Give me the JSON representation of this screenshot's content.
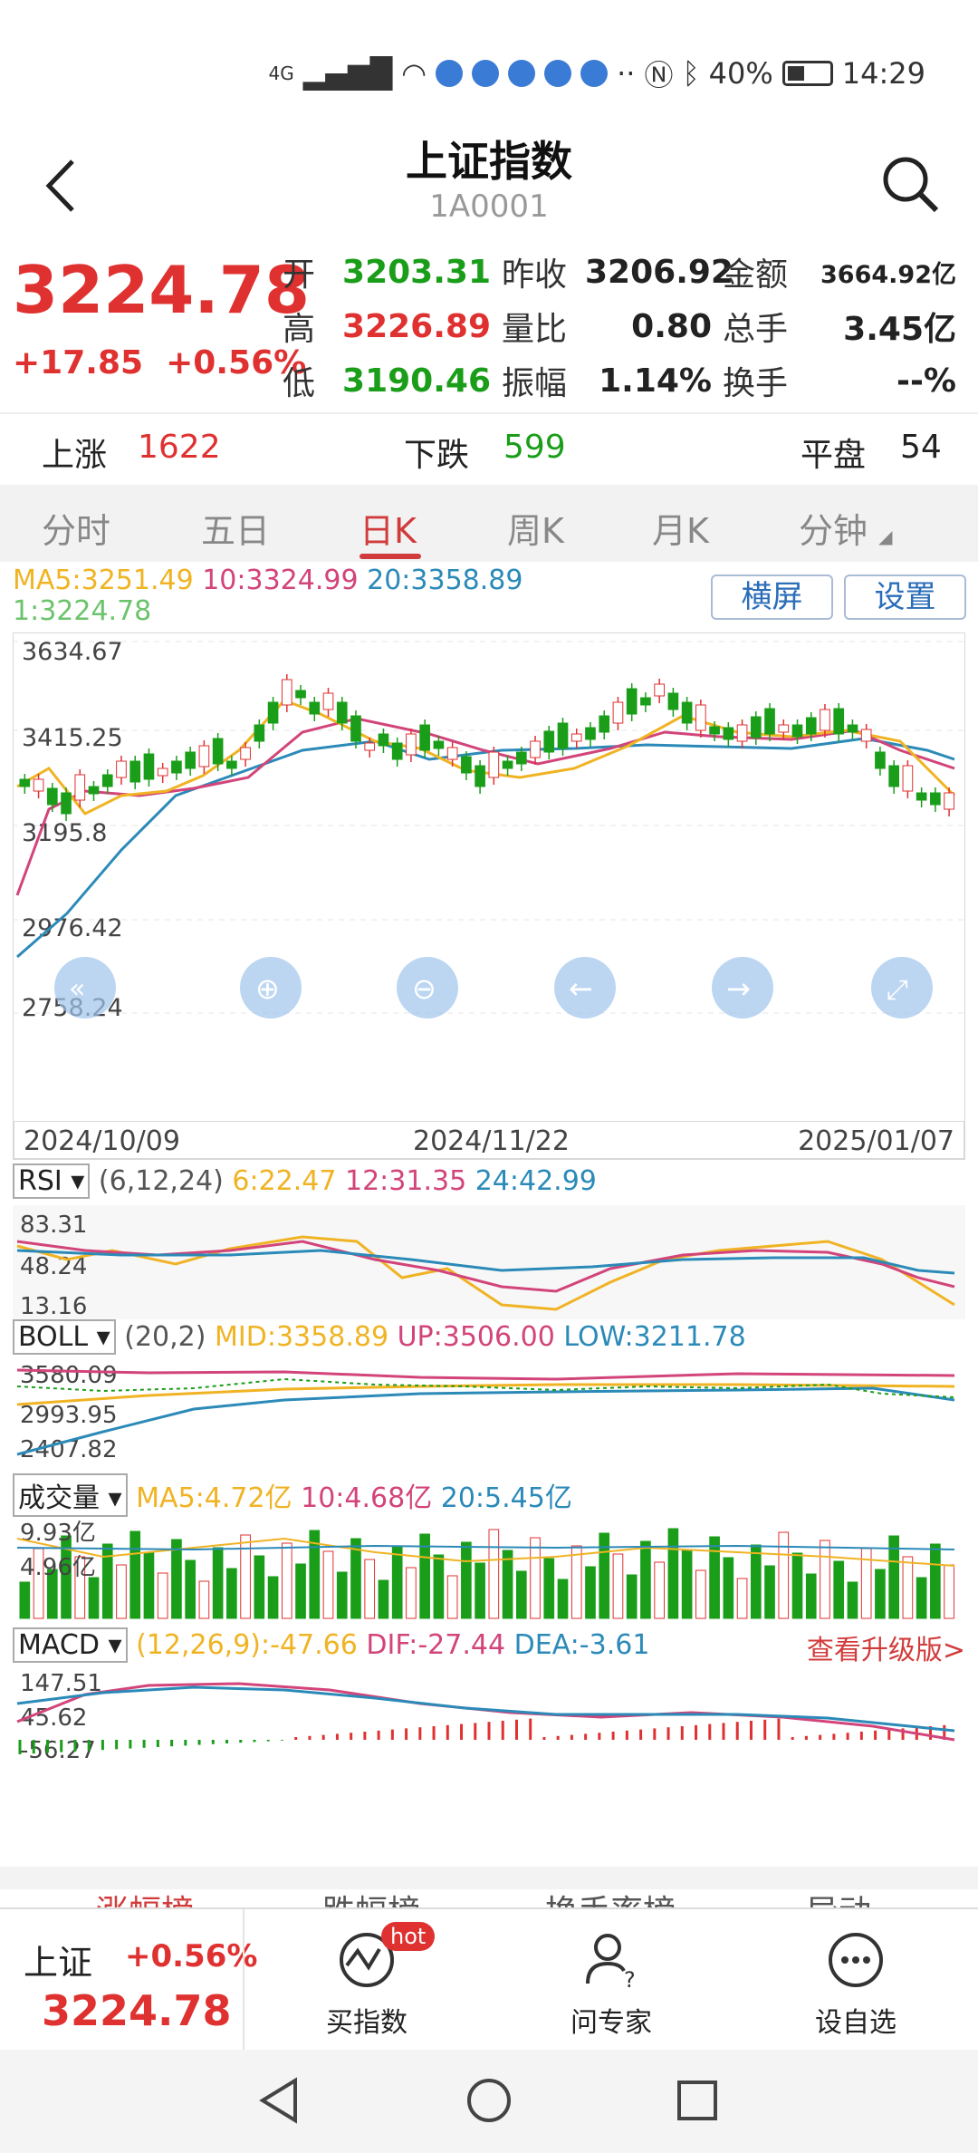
{
  "status": {
    "network": "4G",
    "battery": "40%",
    "time": "14:29"
  },
  "header": {
    "title": "上证指数",
    "code": "1A0001"
  },
  "quote": {
    "price": "3224.78",
    "change": "+17.85",
    "change_pct": "+0.56%",
    "rows": [
      {
        "l1": "开",
        "v1": "3203.31",
        "l2": "昨收",
        "v2": "3206.92",
        "l3": "金额",
        "v3": "3664.92亿"
      },
      {
        "l1": "高",
        "v1": "3226.89",
        "l2": "量比",
        "v2": "0.80",
        "l3": "总手",
        "v3": "3.45亿"
      },
      {
        "l1": "低",
        "v1": "3190.46",
        "l2": "振幅",
        "v2": "1.14%",
        "l3": "换手",
        "v3": "--%"
      }
    ]
  },
  "breadth": {
    "up_label": "上涨",
    "up": "1622",
    "down_label": "下跌",
    "down": "599",
    "flat_label": "平盘",
    "flat": "54"
  },
  "tabs": [
    "分时",
    "五日",
    "日K",
    "周K",
    "月K",
    "分钟"
  ],
  "active_tab": "日K",
  "ma": {
    "ma5": "MA5:3251.49",
    "ma10": "10:3324.99",
    "ma20": "20:3358.89",
    "last": "1:3224.78"
  },
  "buttons": {
    "landscape": "横屏",
    "settings": "设置"
  },
  "kline": {
    "y_ticks": [
      "3634.67",
      "3415.25",
      "3195.8",
      "2976.42",
      "2758.24"
    ],
    "x_ticks": [
      "2024/10/09",
      "2024/11/22",
      "2025/01/07"
    ]
  },
  "rsi": {
    "name": "RSI",
    "params": "(6,12,24)",
    "r6": "6:22.47",
    "r12": "12:31.35",
    "r24": "24:42.99",
    "ticks": [
      "83.31",
      "48.24",
      "13.16"
    ]
  },
  "boll": {
    "name": "BOLL",
    "params": "(20,2)",
    "mid": "MID:3358.89",
    "up": "UP:3506.00",
    "low": "LOW:3211.78",
    "ticks": [
      "3580.09",
      "2993.95",
      "2407.82"
    ]
  },
  "vol": {
    "name": "成交量",
    "ma5": "MA5:4.72亿",
    "ma10": "10:4.68亿",
    "ma20": "20:5.45亿",
    "ticks": [
      "9.93亿",
      "4.96亿"
    ]
  },
  "macd": {
    "name": "MACD",
    "params": "(12,26,9):-47.66",
    "dif": "DIF:-27.44",
    "dea": "DEA:-3.61",
    "upgrade": "查看升级版>",
    "ticks": [
      "147.51",
      "45.62",
      "-56.27"
    ]
  },
  "peek_tabs": [
    "涨幅榜",
    "跌幅榜",
    "换手率榜",
    "异动"
  ],
  "bottombar": {
    "name": "上证",
    "change_pct": "+0.56%",
    "price": "3224.78",
    "buy": "买指数",
    "hot": "hot",
    "ask": "问专家",
    "watch": "设自选"
  },
  "colors": {
    "up": "#e03131",
    "down": "#1a9e1a",
    "ma5": "#f0b323",
    "ma10": "#d2447a",
    "ma20": "#2b8ab8"
  },
  "chart_data": {
    "type": "candlestick",
    "x_range": [
      "2024/10/09",
      "2025/01/07"
    ],
    "ylim": [
      2758.24,
      3634.67
    ],
    "ma_lines": [
      "MA5",
      "MA10",
      "MA20"
    ]
  }
}
